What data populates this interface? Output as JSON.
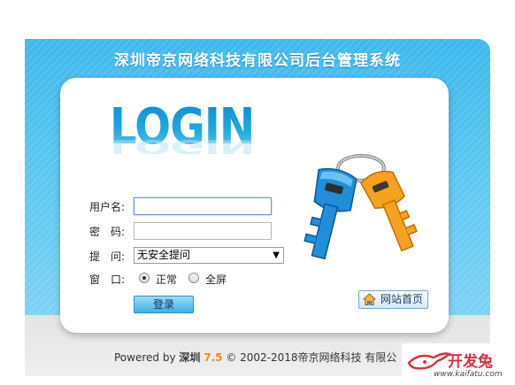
{
  "header": {
    "title": "深圳帝京网络科技有限公司后台管理系统"
  },
  "logo": {
    "text": "LOGIN"
  },
  "form": {
    "username_label": "用户名:",
    "username_value": "",
    "password_label": "密　码:",
    "password_value": "",
    "question_label": "提　问:",
    "question_selected": "无安全提问",
    "window_label": "窗　口:",
    "window_options": [
      "正常",
      "全屏"
    ],
    "window_selected": "正常",
    "submit_label": "登录"
  },
  "home_button": {
    "label": "网站首页",
    "icon": "home-icon"
  },
  "illustration": {
    "icon": "keys-icon"
  },
  "footer": {
    "prefix": "Powered by",
    "brand": "深圳",
    "version": "7.5",
    "copyright": "© 2002-2018帝京网络科技 有限公"
  },
  "watermark": {
    "text": "开发兔",
    "url": "www.kaifatu.com"
  },
  "colors": {
    "panel_blue": "#3db8ec",
    "logo_blue": "#1aa4dc",
    "version_orange": "#f08a1a",
    "watermark_red": "#d9323c"
  }
}
